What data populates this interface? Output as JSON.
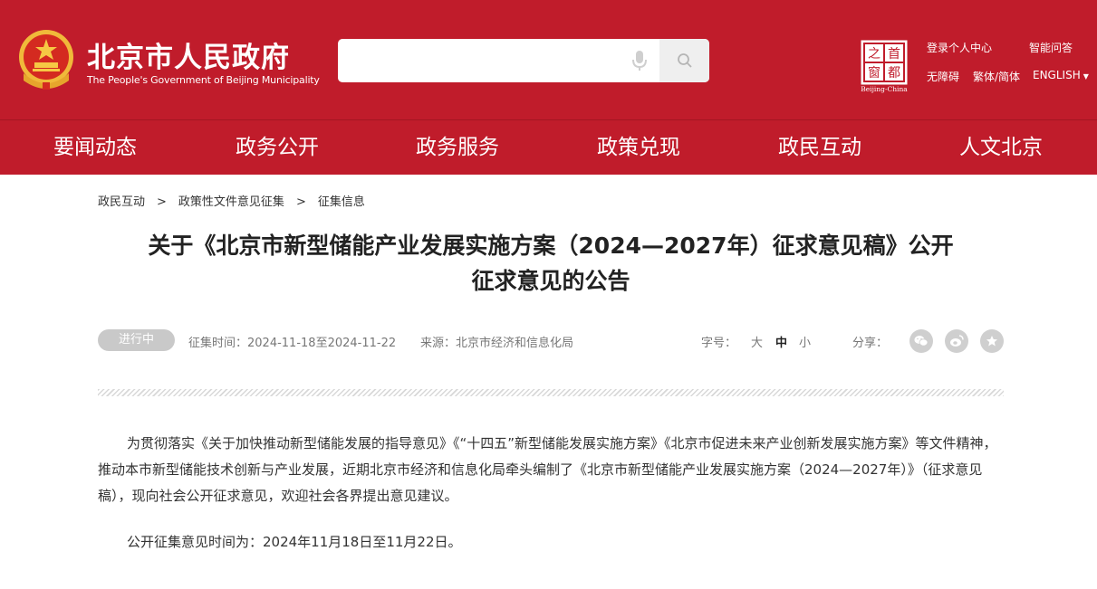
{
  "header": {
    "title": "北京市人民政府",
    "subtitle": "The People's Government of Beijing Municipality",
    "capital_logo": {
      "chars": [
        "之",
        "首",
        "窗",
        "都"
      ],
      "caption": "Beijing-China"
    },
    "links": {
      "login": "登录个人中心",
      "smart_qa": "智能问答",
      "accessible": "无障碍",
      "trad_simp": "繁体/简体",
      "english": "ENGLISH"
    },
    "search": {
      "placeholder": ""
    }
  },
  "nav": {
    "items": [
      "要闻动态",
      "政务公开",
      "政务服务",
      "政策兑现",
      "政民互动",
      "人文北京"
    ]
  },
  "breadcrumb": [
    "政民互动",
    "政策性文件意见征集",
    "征集信息"
  ],
  "article": {
    "title_line1": "关于《北京市新型储能产业发展实施方案（2024—2027年）征求意见稿》公开",
    "title_line2": "征求意见的公告",
    "status": "进行中",
    "period_label": "征集时间：",
    "period_value": "2024-11-18至2024-11-22",
    "source_label": "来源：",
    "source_value": "北京市经济和信息化局",
    "font_label": "字号：",
    "font_sizes": [
      "大",
      "中",
      "小"
    ],
    "share_label": "分享：",
    "paragraphs": [
      "为贯彻落实《关于加快推动新型储能发展的指导意见》《“十四五”新型储能发展实施方案》《北京市促进未来产业创新发展实施方案》等文件精神，推动本市新型储能技术创新与产业发展，近期北京市经济和信息化局牵头编制了《北京市新型储能产业发展实施方案（2024—2027年）》（征求意见稿），现向社会公开征求意见，欢迎社会各界提出意见建议。",
      "公开征集意见时间为：2024年11月18日至11月22日。"
    ]
  },
  "colors": {
    "brand_red": "#c01c2b",
    "badge_gray": "#c9c9c9"
  },
  "icons": [
    "national-emblem-icon",
    "microphone-icon",
    "search-icon",
    "wechat-icon",
    "weibo-icon",
    "favorite-star-icon"
  ]
}
